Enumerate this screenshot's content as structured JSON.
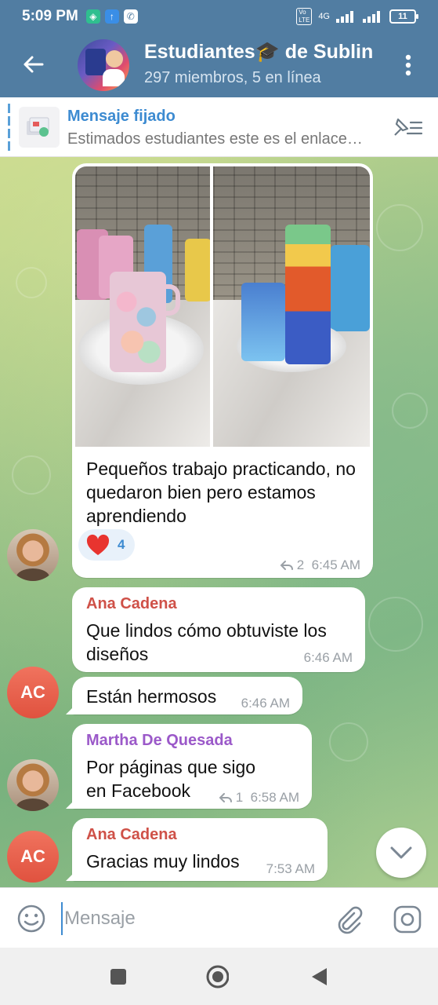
{
  "status_bar": {
    "time": "5:09 PM",
    "network": "4G",
    "battery": "11"
  },
  "header": {
    "title": "Estudiantes🎓 de Sublin",
    "subtitle": "297 miembros, 5 en línea"
  },
  "pinned": {
    "label": "Mensaje fijado",
    "text": "Estimados estudiantes este es el enlace…"
  },
  "messages": [
    {
      "text": "Pequeños trabajo practicando, no quedaron bien pero estamos aprendiendo",
      "reaction_emoji": "heart",
      "reaction_count": "4",
      "replies": "2",
      "time": "6:45 AM"
    },
    {
      "sender": "Ana Cadena",
      "text": "Que lindos cómo obtuviste los diseños",
      "time": "6:46 AM"
    },
    {
      "avatar_initials": "AC",
      "text": "Están hermosos",
      "time": "6:46 AM"
    },
    {
      "sender": "Martha De Quesada",
      "text": "Por páginas que sigo en Facebook",
      "replies": "1",
      "time": "6:58 AM"
    },
    {
      "sender": "Ana Cadena",
      "avatar_initials": "AC",
      "text": "Gracias muy lindos",
      "time": "7:53 AM"
    }
  ],
  "input": {
    "placeholder": "Mensaje"
  },
  "colors": {
    "header": "#517da2",
    "accent": "#3d8bd1",
    "sender_ana": "#cf5148",
    "sender_martha": "#9b59c9",
    "avatar_ac": "#e8604c"
  }
}
